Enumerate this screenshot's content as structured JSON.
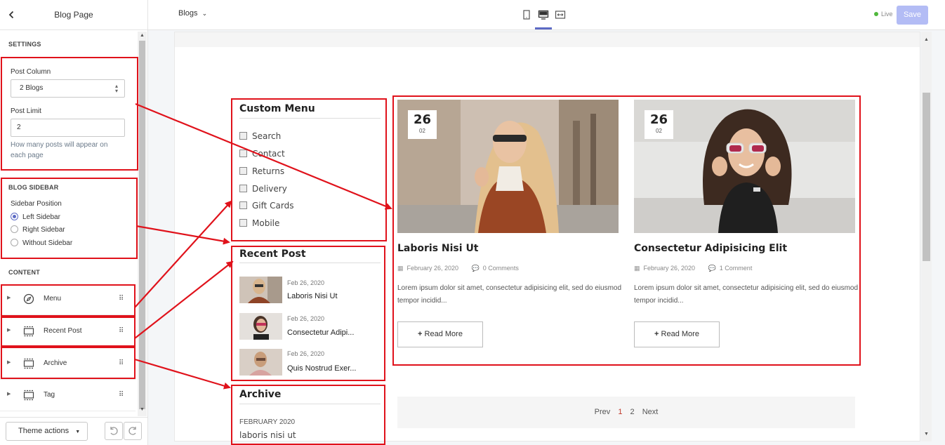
{
  "left_panel": {
    "title": "Blog Page",
    "settings_title": "SETTINGS",
    "post_column_label": "Post Column",
    "post_column_value": "2 Blogs",
    "post_limit_label": "Post Limit",
    "post_limit_value": "2",
    "post_limit_help": "How many posts will appear on each page",
    "blog_sidebar_title": "BLOG SIDEBAR",
    "sidebar_position_label": "Sidebar Position",
    "sidebar_options": [
      {
        "label": "Left Sidebar",
        "checked": true
      },
      {
        "label": "Right Sidebar",
        "checked": false
      },
      {
        "label": "Without Sidebar",
        "checked": false
      }
    ],
    "content_title": "CONTENT",
    "content_items": [
      {
        "label": "Menu",
        "icon": "compass-icon"
      },
      {
        "label": "Recent Post",
        "icon": "section-icon"
      },
      {
        "label": "Archive",
        "icon": "section-icon"
      },
      {
        "label": "Tag",
        "icon": "section-icon"
      }
    ],
    "theme_actions_label": "Theme actions"
  },
  "topbar": {
    "page_select": "Blogs",
    "devices": [
      "mobile-icon",
      "desktop-icon",
      "fullwidth-icon"
    ],
    "live_label": "Live",
    "save_label": "Save"
  },
  "preview": {
    "custom_menu": {
      "title": "Custom Menu",
      "items": [
        "Search",
        "Contact",
        "Returns",
        "Delivery",
        "Gift Cards",
        "Mobile"
      ]
    },
    "recent_post": {
      "title": "Recent Post",
      "posts": [
        {
          "date": "Feb 26, 2020",
          "title": "Laboris Nisi Ut"
        },
        {
          "date": "Feb 26, 2020",
          "title": "Consectetur Adipi..."
        },
        {
          "date": "Feb 26, 2020",
          "title": "Quis Nostrud Exer..."
        }
      ]
    },
    "archive": {
      "title": "Archive",
      "month": "FEBRUARY 2020",
      "item": "laboris nisi ut"
    },
    "posts": [
      {
        "day": "26",
        "month": "02",
        "title": "Laboris Nisi Ut",
        "date": "February 26, 2020",
        "comments": "0 Comments",
        "excerpt": "Lorem ipsum dolor sit amet, consectetur adipisicing elit, sed do eiusmod tempor incidid...",
        "read_more": "Read More"
      },
      {
        "day": "26",
        "month": "02",
        "title": "Consectetur Adipisicing Elit",
        "date": "February 26, 2020",
        "comments": "1 Comment",
        "excerpt": "Lorem ipsum dolor sit amet, consectetur adipisicing elit, sed do eiusmod tempor incidid...",
        "read_more": "Read More"
      }
    ],
    "pagination": {
      "prev": "Prev",
      "pages": [
        "1",
        "2"
      ],
      "next": "Next"
    }
  },
  "colors": {
    "accent": "#5c6ac4",
    "annotation_red": "#e0121b",
    "save_disabled": "#b3bcf5",
    "live_green": "#50b83c",
    "current_page": "#c0392b"
  }
}
